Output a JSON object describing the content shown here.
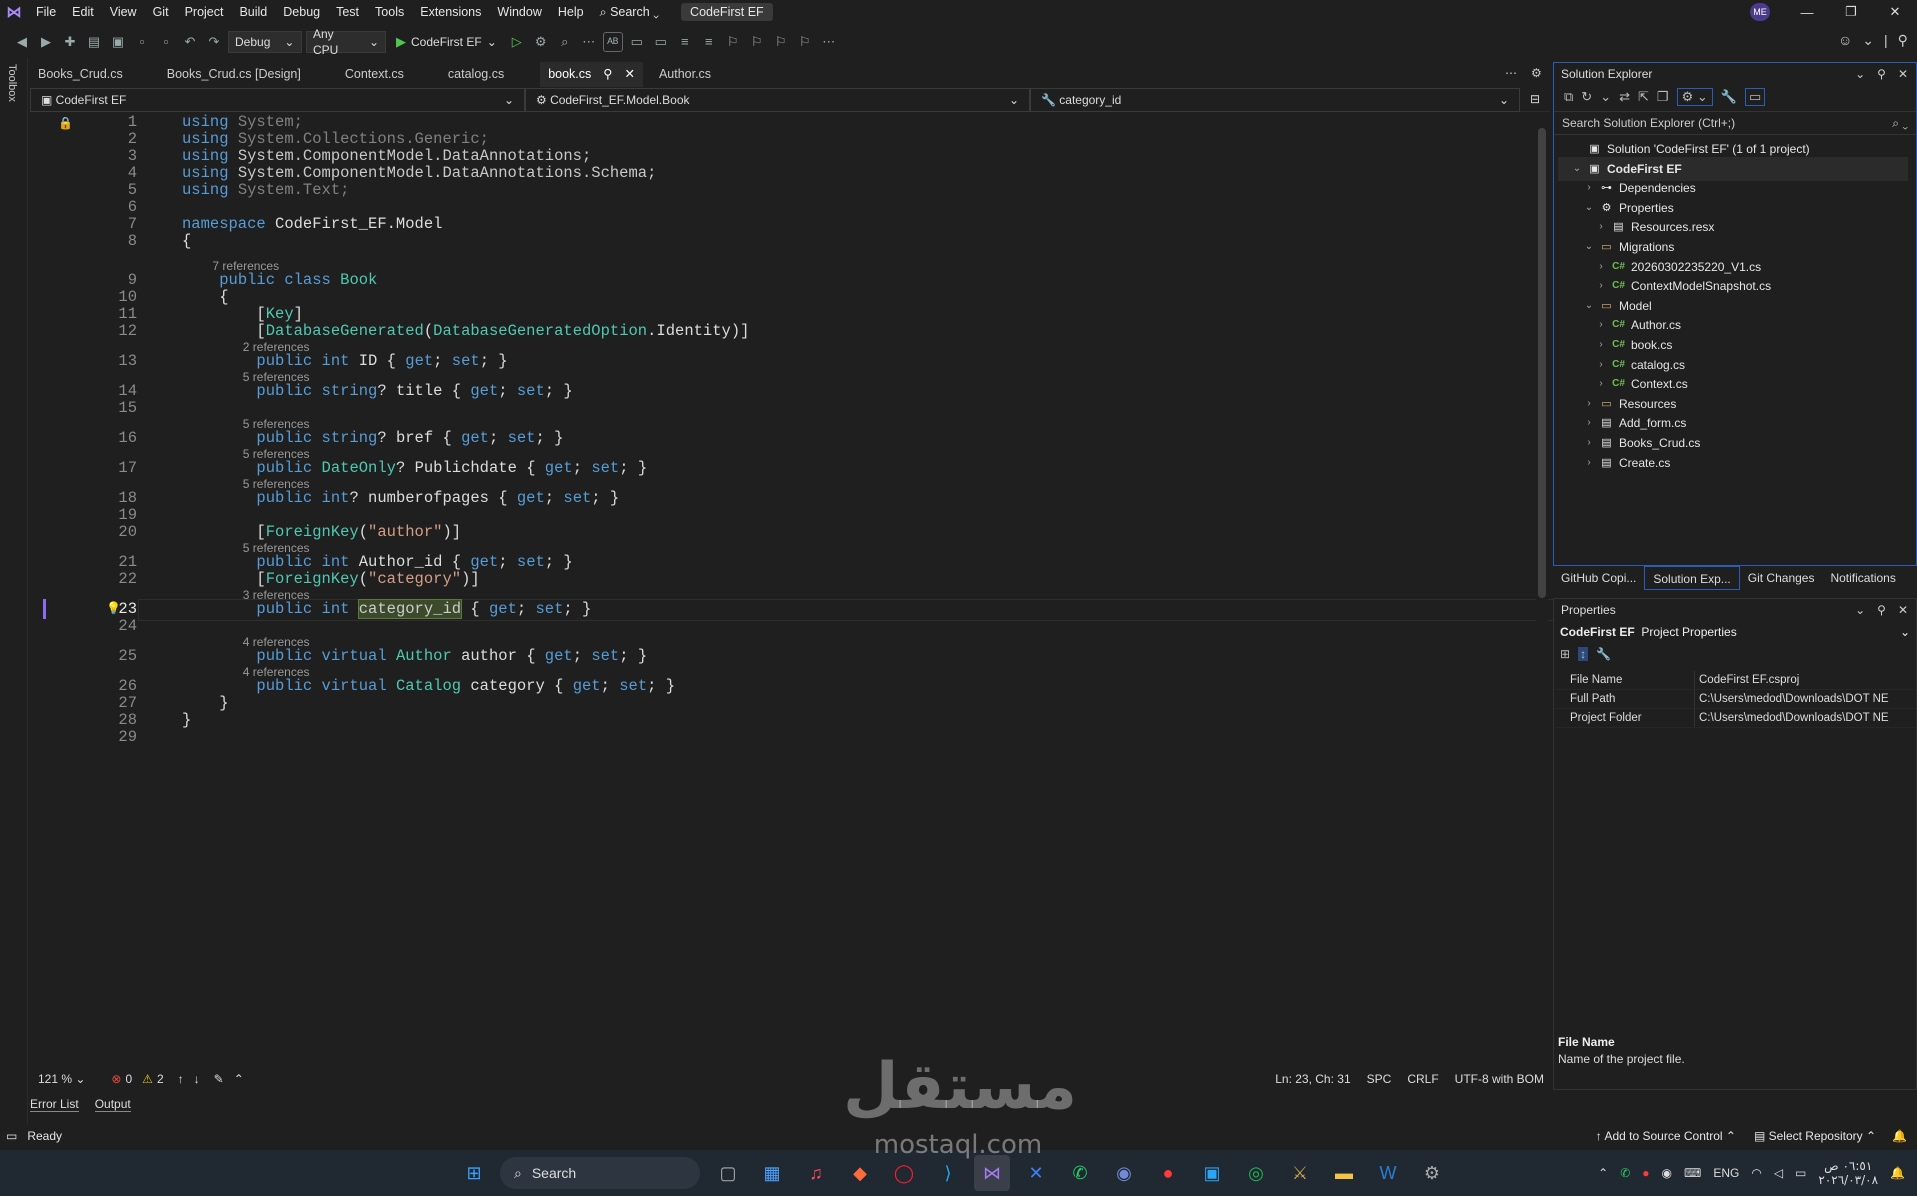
{
  "menu": [
    "File",
    "Edit",
    "View",
    "Git",
    "Project",
    "Build",
    "Debug",
    "Test",
    "Tools",
    "Extensions",
    "Window",
    "Help"
  ],
  "menu_search": "Search",
  "solution_badge": "CodeFirst EF",
  "avatar": "ME",
  "toolbar": {
    "config": "Debug",
    "platform": "Any CPU",
    "run_target": "CodeFirst EF"
  },
  "toolbox_label": "Toolbox",
  "tabs": [
    "Books_Crud.cs",
    "Books_Crud.cs [Design]",
    "Context.cs",
    "catalog.cs",
    "book.cs",
    "Author.cs"
  ],
  "navbar": {
    "project": "CodeFirst EF",
    "type": "CodeFirst_EF.Model.Book",
    "member": "category_id"
  },
  "code_lines": [
    {
      "n": "1",
      "parts": [
        [
          "kw",
          "using "
        ],
        [
          "dim",
          "System;"
        ]
      ]
    },
    {
      "n": "2",
      "parts": [
        [
          "kw",
          "using "
        ],
        [
          "dim",
          "System.Collections.Generic;"
        ]
      ]
    },
    {
      "n": "3",
      "parts": [
        [
          "kw",
          "using "
        ],
        [
          "ns",
          "System.ComponentModel.DataAnnotations;"
        ]
      ]
    },
    {
      "n": "4",
      "parts": [
        [
          "kw",
          "using "
        ],
        [
          "ns",
          "System.ComponentModel.DataAnnotations.Schema;"
        ]
      ]
    },
    {
      "n": "5",
      "parts": [
        [
          "kw",
          "using "
        ],
        [
          "dim",
          "System.Text;"
        ]
      ]
    },
    {
      "n": "6",
      "parts": []
    },
    {
      "n": "7",
      "parts": [
        [
          "kw",
          "namespace "
        ],
        [
          "pl",
          "CodeFirst_EF.Model"
        ]
      ]
    },
    {
      "n": "8",
      "parts": [
        [
          "pl",
          "{"
        ]
      ]
    },
    {
      "n": "9",
      "ref": "7 references",
      "parts": [
        [
          "pl",
          "    "
        ],
        [
          "kw",
          "public class "
        ],
        [
          "ty",
          "Book"
        ]
      ]
    },
    {
      "n": "10",
      "parts": [
        [
          "pl",
          "    {"
        ]
      ]
    },
    {
      "n": "11",
      "parts": [
        [
          "pl",
          "        ["
        ],
        [
          "ty",
          "Key"
        ],
        [
          "pl",
          "]"
        ]
      ]
    },
    {
      "n": "12",
      "parts": [
        [
          "pl",
          "        ["
        ],
        [
          "ty",
          "DatabaseGenerated"
        ],
        [
          "pl",
          "("
        ],
        [
          "ty",
          "DatabaseGeneratedOption"
        ],
        [
          "pl",
          ".Identity)]"
        ]
      ]
    },
    {
      "n": "13",
      "ref": "2 references",
      "parts": [
        [
          "pl",
          "        "
        ],
        [
          "kw",
          "public int "
        ],
        [
          "pl",
          "ID { "
        ],
        [
          "kw",
          "get"
        ],
        [
          "pl",
          "; "
        ],
        [
          "kw",
          "set"
        ],
        [
          "pl",
          "; }"
        ]
      ]
    },
    {
      "n": "14",
      "ref": "5 references",
      "parts": [
        [
          "pl",
          "        "
        ],
        [
          "kw",
          "public string"
        ],
        [
          "pl",
          "? title { "
        ],
        [
          "kw",
          "get"
        ],
        [
          "pl",
          "; "
        ],
        [
          "kw",
          "set"
        ],
        [
          "pl",
          "; }"
        ]
      ]
    },
    {
      "n": "15",
      "parts": []
    },
    {
      "n": "16",
      "ref": "5 references",
      "parts": [
        [
          "pl",
          "        "
        ],
        [
          "kw",
          "public string"
        ],
        [
          "pl",
          "? bref { "
        ],
        [
          "kw",
          "get"
        ],
        [
          "pl",
          "; "
        ],
        [
          "kw",
          "set"
        ],
        [
          "pl",
          "; }"
        ]
      ]
    },
    {
      "n": "17",
      "ref": "5 references",
      "parts": [
        [
          "pl",
          "        "
        ],
        [
          "kw",
          "public "
        ],
        [
          "ty",
          "DateOnly"
        ],
        [
          "pl",
          "? Publichdate { "
        ],
        [
          "kw",
          "get"
        ],
        [
          "pl",
          "; "
        ],
        [
          "kw",
          "set"
        ],
        [
          "pl",
          "; }"
        ]
      ]
    },
    {
      "n": "18",
      "ref": "5 references",
      "parts": [
        [
          "pl",
          "        "
        ],
        [
          "kw",
          "public int"
        ],
        [
          "pl",
          "? numberofpages { "
        ],
        [
          "kw",
          "get"
        ],
        [
          "pl",
          "; "
        ],
        [
          "kw",
          "set"
        ],
        [
          "pl",
          "; }"
        ]
      ]
    },
    {
      "n": "19",
      "parts": []
    },
    {
      "n": "20",
      "parts": [
        [
          "pl",
          "        ["
        ],
        [
          "ty",
          "ForeignKey"
        ],
        [
          "pl",
          "("
        ],
        [
          "st",
          "\"author\""
        ],
        [
          "pl",
          ")]"
        ]
      ]
    },
    {
      "n": "21",
      "ref": "5 references",
      "parts": [
        [
          "pl",
          "        "
        ],
        [
          "kw",
          "public int "
        ],
        [
          "pl",
          "Author_id { "
        ],
        [
          "kw",
          "get"
        ],
        [
          "pl",
          "; "
        ],
        [
          "kw",
          "set"
        ],
        [
          "pl",
          "; }"
        ]
      ]
    },
    {
      "n": "22",
      "parts": [
        [
          "pl",
          "        ["
        ],
        [
          "ty",
          "ForeignKey"
        ],
        [
          "pl",
          "("
        ],
        [
          "st",
          "\"category\""
        ],
        [
          "pl",
          ")]"
        ]
      ]
    },
    {
      "n": "23",
      "ref": "3 references",
      "cur": true,
      "parts": [
        [
          "pl",
          "        "
        ],
        [
          "kw",
          "public int "
        ],
        [
          "hl",
          "category_id"
        ],
        [
          "pl",
          " { "
        ],
        [
          "kw",
          "get"
        ],
        [
          "pl",
          "; "
        ],
        [
          "kw",
          "set"
        ],
        [
          "pl",
          "; }"
        ]
      ]
    },
    {
      "n": "24",
      "parts": []
    },
    {
      "n": "25",
      "ref": "4 references",
      "parts": [
        [
          "pl",
          "        "
        ],
        [
          "kw",
          "public virtual "
        ],
        [
          "ty",
          "Author "
        ],
        [
          "pl",
          "author { "
        ],
        [
          "kw",
          "get"
        ],
        [
          "pl",
          "; "
        ],
        [
          "kw",
          "set"
        ],
        [
          "pl",
          "; }"
        ]
      ]
    },
    {
      "n": "26",
      "ref": "4 references",
      "parts": [
        [
          "pl",
          "        "
        ],
        [
          "kw",
          "public virtual "
        ],
        [
          "ty",
          "Catalog "
        ],
        [
          "pl",
          "category { "
        ],
        [
          "kw",
          "get"
        ],
        [
          "pl",
          "; "
        ],
        [
          "kw",
          "set"
        ],
        [
          "pl",
          "; }"
        ]
      ]
    },
    {
      "n": "27",
      "parts": [
        [
          "pl",
          "    }"
        ]
      ]
    },
    {
      "n": "28",
      "parts": [
        [
          "pl",
          "}"
        ]
      ]
    },
    {
      "n": "29",
      "parts": []
    }
  ],
  "editor_status": {
    "zoom": "121 %",
    "errors": "0",
    "warnings": "2",
    "position": "Ln: 23, Ch: 31",
    "spc": "SPC",
    "crlf": "CRLF",
    "encoding": "UTF-8 with BOM"
  },
  "bottom_tabs": [
    "Error List",
    "Output"
  ],
  "statusbar": {
    "ready": "Ready",
    "source_control": "Add to Source Control",
    "repository": "Select Repository"
  },
  "solution_explorer": {
    "title": "Solution Explorer",
    "search_placeholder": "Search Solution Explorer (Ctrl+;)",
    "items": [
      {
        "label": "Solution 'CodeFirst EF' (1 of 1 project)",
        "icon": "solution-icon"
      },
      {
        "label": "CodeFirst EF",
        "icon": "project-icon"
      },
      {
        "label": "Dependencies",
        "icon": "dependencies-icon"
      },
      {
        "label": "Properties",
        "icon": "properties-icon"
      },
      {
        "label": "Resources.resx",
        "icon": "resx-icon"
      },
      {
        "label": "Migrations",
        "icon": "folder-icon"
      },
      {
        "label": "20260302235220_V1.cs",
        "icon": "csharp-icon"
      },
      {
        "label": "ContextModelSnapshot.cs",
        "icon": "csharp-icon"
      },
      {
        "label": "Model",
        "icon": "folder-icon"
      },
      {
        "label": "Author.cs",
        "icon": "csharp-icon"
      },
      {
        "label": "book.cs",
        "icon": "csharp-icon"
      },
      {
        "label": "catalog.cs",
        "icon": "csharp-icon"
      },
      {
        "label": "Context.cs",
        "icon": "csharp-icon"
      },
      {
        "label": "Resources",
        "icon": "folder-icon"
      },
      {
        "label": "Add_form.cs",
        "icon": "form-icon"
      },
      {
        "label": "Books_Crud.cs",
        "icon": "form-icon"
      },
      {
        "label": "Create.cs",
        "icon": "form-icon"
      }
    ]
  },
  "panel_tabs": [
    "GitHub Copi...",
    "Solution Exp...",
    "Git Changes",
    "Notifications"
  ],
  "properties": {
    "title": "Properties",
    "subject_name": "CodeFirst EF",
    "subject_type": "Project Properties",
    "rows": [
      {
        "k": "File Name",
        "v": "CodeFirst EF.csproj"
      },
      {
        "k": "Full Path",
        "v": "C:\\Users\\medod\\Downloads\\DOT NE"
      },
      {
        "k": "Project Folder",
        "v": "C:\\Users\\medod\\Downloads\\DOT NE"
      }
    ],
    "desc_title": "File Name",
    "desc_text": "Name of the project file."
  },
  "taskbar": {
    "search": "Search",
    "lang": "ENG",
    "time": "٠٦:٥١ ص",
    "date": "٢٠٢٦/٠٣/٠٨"
  },
  "watermark": {
    "arabic": "مستقل",
    "latin": "mostaql.com"
  }
}
